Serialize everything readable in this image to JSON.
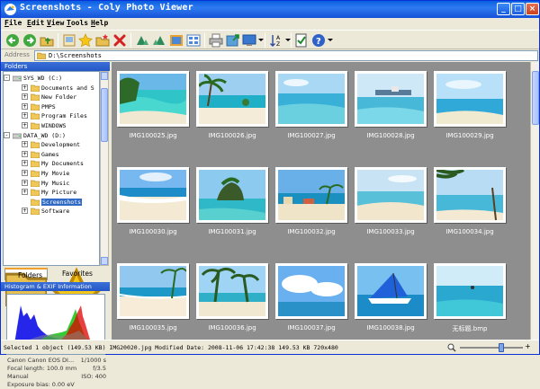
{
  "window": {
    "title": "Screenshots - Coly Photo Viewer"
  },
  "menu": [
    {
      "label": "File",
      "key": "F",
      "rest": "ile"
    },
    {
      "label": "Edit",
      "key": "E",
      "rest": "dit"
    },
    {
      "label": "View",
      "key": "V",
      "rest": "iew"
    },
    {
      "label": "Tools",
      "key": "T",
      "rest": "ools"
    },
    {
      "label": "Help",
      "key": "H",
      "rest": "elp"
    }
  ],
  "toolbar": {
    "icons": [
      "back-icon",
      "forward-icon",
      "up-folder-icon",
      "slideshow-icon",
      "favorite-star-icon",
      "add-to-favorites-icon",
      "delete-icon",
      "rotate-left-icon",
      "rotate-right-icon",
      "filmstrip-icon",
      "thumbnails-view-icon",
      "print-icon",
      "export-icon",
      "sort-icon",
      "select-icon",
      "help-icon"
    ]
  },
  "address": {
    "label": "Address",
    "value": "D:\\Screenshots"
  },
  "folders_panel": {
    "header": "Folders",
    "tree": [
      {
        "label": "SYS_WD (C:)",
        "level": 0,
        "expander": "-",
        "icon": "drive"
      },
      {
        "label": "Documents and S",
        "level": 1,
        "expander": "+",
        "icon": "folder"
      },
      {
        "label": "New Folder",
        "level": 1,
        "expander": "+",
        "icon": "folder"
      },
      {
        "label": "PMPS",
        "level": 1,
        "expander": "+",
        "icon": "folder"
      },
      {
        "label": "Program Files",
        "level": 1,
        "expander": "+",
        "icon": "folder"
      },
      {
        "label": "WINDOWS",
        "level": 1,
        "expander": "+",
        "icon": "folder"
      },
      {
        "label": "DATA_WD (D:)",
        "level": 0,
        "expander": "-",
        "icon": "drive"
      },
      {
        "label": "Development",
        "level": 1,
        "expander": "+",
        "icon": "folder"
      },
      {
        "label": "Games",
        "level": 1,
        "expander": "+",
        "icon": "folder"
      },
      {
        "label": "My Documents",
        "level": 1,
        "expander": "+",
        "icon": "folder"
      },
      {
        "label": "My Movie",
        "level": 1,
        "expander": "+",
        "icon": "folder"
      },
      {
        "label": "My Music",
        "level": 1,
        "expander": "+",
        "icon": "folder"
      },
      {
        "label": "My Picture",
        "level": 1,
        "expander": "+",
        "icon": "folder"
      },
      {
        "label": "Screenshots",
        "level": 1,
        "expander": "",
        "icon": "folder",
        "selected": true
      },
      {
        "label": "Software",
        "level": 1,
        "expander": "+",
        "icon": "folder"
      }
    ]
  },
  "tabs": {
    "folders": "Folders",
    "favorites": "Favorites"
  },
  "histogram_panel": {
    "header": "Histogram & EXIF Information"
  },
  "exif": [
    {
      "left": "Canon Canon EOS DI...",
      "right": "1/1000 s"
    },
    {
      "left": "Focal length: 100.0 mm",
      "right": "f/3.5"
    },
    {
      "left": "Manual",
      "right": "ISO: 400"
    },
    {
      "left": "Exposure bias: 0.00 eV",
      "right": ""
    }
  ],
  "thumbnails": [
    {
      "name": "IMG100025.jpg",
      "scene": "lagoon"
    },
    {
      "name": "IMG100026.jpg",
      "scene": "palm-beach"
    },
    {
      "name": "IMG100027.jpg",
      "scene": "open-sea"
    },
    {
      "name": "IMG100028.jpg",
      "scene": "pier"
    },
    {
      "name": "IMG100029.jpg",
      "scene": "sky-sea"
    },
    {
      "name": "IMG100030.jpg",
      "scene": "shore"
    },
    {
      "name": "IMG100031.jpg",
      "scene": "rock-island"
    },
    {
      "name": "IMG100032.jpg",
      "scene": "resort"
    },
    {
      "name": "IMG100033.jpg",
      "scene": "calm-bay"
    },
    {
      "name": "IMG100034.jpg",
      "scene": "palm-frame"
    },
    {
      "name": "IMG100035.jpg",
      "scene": "beach-walk"
    },
    {
      "name": "IMG100036.jpg",
      "scene": "palms"
    },
    {
      "name": "IMG100037.jpg",
      "scene": "clouds"
    },
    {
      "name": "IMG100038.jpg",
      "scene": "sailboat"
    },
    {
      "name": "无标题.bmp",
      "scene": "horizon"
    }
  ],
  "status": {
    "text": "Selected 1 object (149.53 KB) IMG20020.jpg Modified Date: 2008-11-06 17:42:38 149.53 KB 720x480"
  },
  "zoom": {
    "level": 0.65
  }
}
